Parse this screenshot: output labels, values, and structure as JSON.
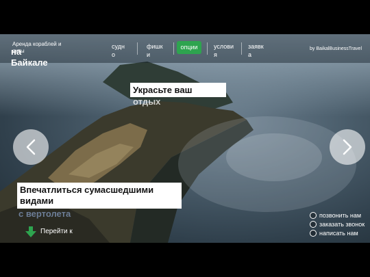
{
  "brand": {
    "line1": "Аренда кораблей и",
    "line2": "яхты",
    "big1": "на",
    "big2": "Байкале"
  },
  "nav": {
    "items": [
      {
        "label1": "судн",
        "label2": "о"
      },
      {
        "label1": "фишк",
        "label2": "и"
      },
      {
        "label1": "опции",
        "label2": ""
      },
      {
        "label1": "услови",
        "label2": "я"
      },
      {
        "label1": "заявк",
        "label2": "а"
      }
    ],
    "active_index": 2
  },
  "by_line": "by BaikalBusinessTravel",
  "heading": {
    "box": "Украсьте ваш",
    "tail": "отдых"
  },
  "caption": {
    "line1": "Впечатлиться сумасшедшими",
    "line2": "видами",
    "tail": "с вертолета"
  },
  "goto": {
    "label": "Перейти к"
  },
  "contacts": [
    "позвонить нам",
    "заказать звонок",
    "написать нам"
  ],
  "slider": {
    "prev_icon": "chevron-left-icon",
    "next_icon": "chevron-right-icon"
  },
  "colors": {
    "accent": "#2ea44f",
    "black_band": "#000000"
  }
}
